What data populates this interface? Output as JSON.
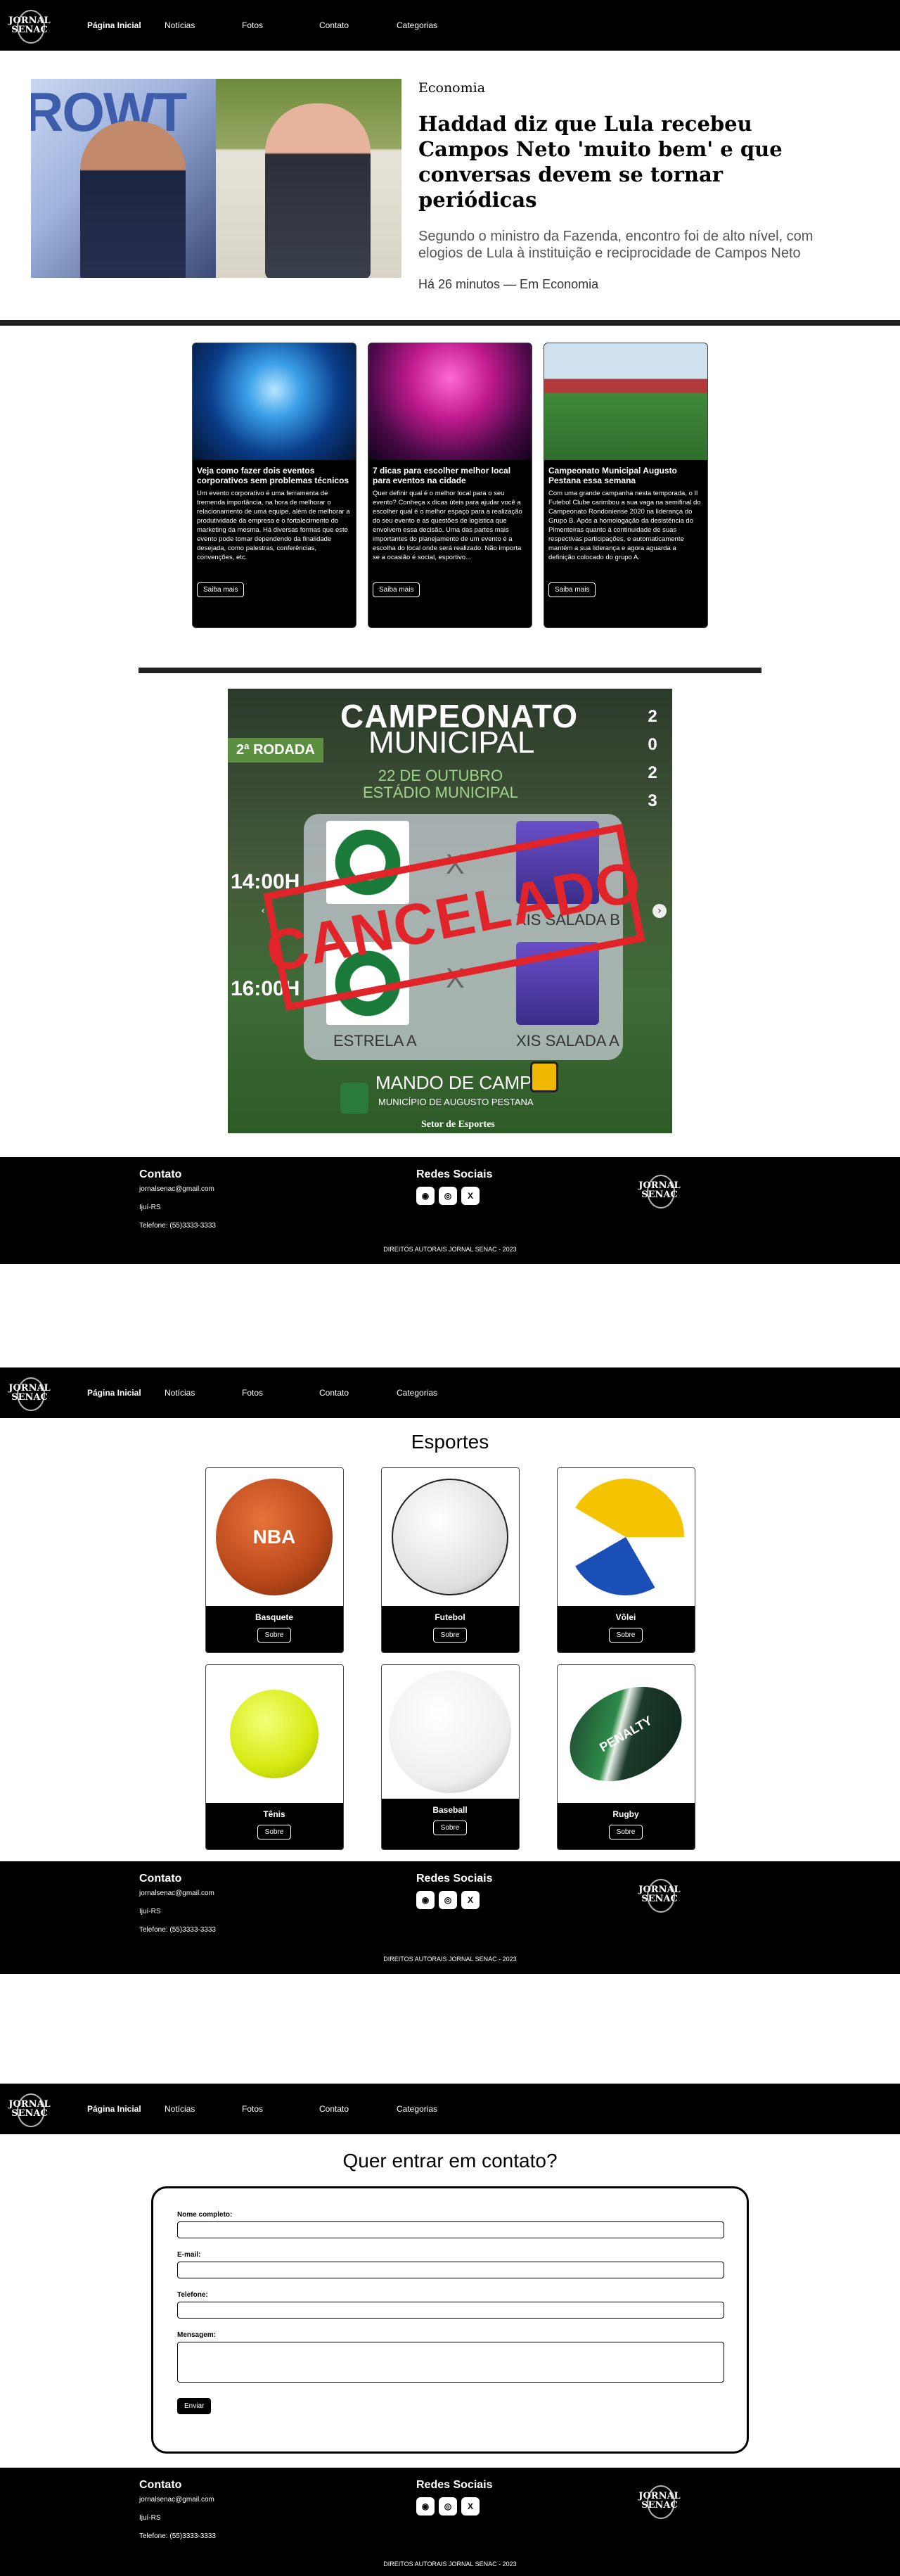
{
  "brand": {
    "logo_line1": "JORNAL",
    "logo_line2": "SENAC"
  },
  "nav": {
    "items": [
      "Página Inicial",
      "Notícias",
      "Fotos",
      "Contato",
      "Categorias"
    ]
  },
  "home": {
    "hero": {
      "image_word": "ROWT",
      "category": "Economia",
      "title": "Haddad diz que Lula recebeu Campos Neto 'muito bem' e que conversas devem se tornar periódicas",
      "subtitle": "Segundo o ministro da Fazenda, encontro foi de alto nível, com elogios de Lula à instituição e reciprocidade de Campos Neto",
      "time": "Há 26 minutos — Em Economia"
    },
    "cards": [
      {
        "title": "Veja como fazer dois eventos corporativos sem problemas técnicos",
        "text": "Um evento corporativo é uma ferramenta de tremenda importância, na hora de melhorar o relacionamento de uma equipe, além de melhorar a produtividade da empresa e o fortalecimento do marketing da mesma. Há diversas formas que este evento pode tomar dependendo da finalidade desejada, como palestras, conferências, convenções, etc.",
        "button": "Saiba mais"
      },
      {
        "title": "7 dicas para escolher melhor local para eventos na cidade",
        "text": "Quer definir qual é o melhor local para o seu evento? Conheça x dicas úteis para ajudar você a escolher qual é o melhor espaço para a realização do seu evento e as questões de logística que envolvem essa decisão. Uma das partes mais importantes do planejamento de um evento é a escolha do local onde será realizado. Não importa se a ocasião é social, esportivo...",
        "button": "Saiba mais"
      },
      {
        "title": "Campeonato Municipal Augusto Pestana essa semana",
        "text": "Com uma grande campanha nesta temporada, o Il Futebol Clube carimbou a sua vaga na semifinal do Campeonato Rondoniense 2020 na liderança do Grupo B. Após a homologação da desistência do Pimenteiras quanto à continuidade de suas respectivas participações, e automaticamente mantém a sua liderança e agora aguarda a definição colocado do grupo A.",
        "button": "Saiba mais"
      }
    ],
    "poster": {
      "title_line1": "CAMPEONATO",
      "title_line2": "MUNICIPAL",
      "date": "22 DE OUTUBRO",
      "venue": "ESTÁDIO MUNICIPAL",
      "year": "2 0 2 3",
      "round": "2ª RODADA",
      "time1": "14:00H",
      "time2": "16:00H",
      "team_x": "X",
      "team_b1": "XIS SALADA B",
      "team_a_label": "ESTRELA A",
      "team_a2": "XIS SALADA A",
      "stamp": "CANCELADO",
      "mando": "MANDO DE CAMPO:",
      "org": "MUNICÍPIO DE AUGUSTO PESTANA",
      "setor": "Setor de Esportes",
      "prev": "‹",
      "next": "›"
    }
  },
  "footer": {
    "contato_title": "Contato",
    "email": "jornalsenac@gmail.com",
    "city": "Ijuí-RS",
    "phone": "Telefone: (55)3333-3333",
    "redes_title": "Redes Sociais",
    "icons": [
      "whatsapp-icon",
      "instagram-icon",
      "x-icon"
    ],
    "icon_glyphs": [
      "◉",
      "◎",
      "X"
    ],
    "copyright": "DIREITOS AUTORAIS JORNAL SENAC - 2023"
  },
  "sports": {
    "title": "Esportes",
    "items": [
      {
        "name": "Basquete",
        "button": "Sobre",
        "ball_label": "NBA"
      },
      {
        "name": "Futebol",
        "button": "Sobre",
        "ball_label": ""
      },
      {
        "name": "Vôlei",
        "button": "Sobre",
        "ball_label": ""
      },
      {
        "name": "Tênis",
        "button": "Sobre",
        "ball_label": ""
      },
      {
        "name": "Baseball",
        "button": "Sobre",
        "ball_label": ""
      },
      {
        "name": "Rugby",
        "button": "Sobre",
        "ball_label": "PENALTY"
      }
    ]
  },
  "contact": {
    "title": "Quer entrar em contato?",
    "name_label": "Nome completo:",
    "email_label": "E-mail:",
    "phone_label": "Telefone:",
    "message_label": "Mensagem:",
    "send": "Enviar"
  }
}
